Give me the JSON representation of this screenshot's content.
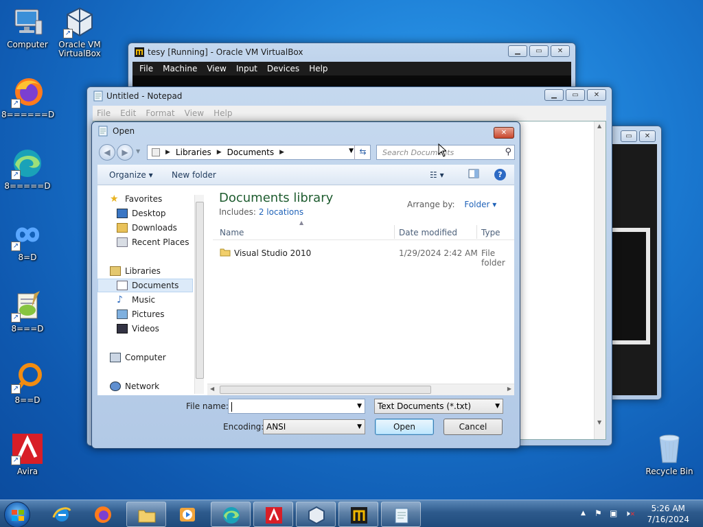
{
  "desktop": {
    "icons": [
      {
        "label": "Computer"
      },
      {
        "label": "Oracle VM VirtualBox"
      },
      {
        "label": "8======D"
      },
      {
        "label": "8=====D"
      },
      {
        "label": "8=D"
      },
      {
        "label": "8===D"
      },
      {
        "label": "8==D"
      },
      {
        "label": "Avira"
      },
      {
        "label": "Recycle Bin"
      }
    ]
  },
  "vbox": {
    "title": "tesy [Running] - Oracle VM VirtualBox",
    "menu": [
      "File",
      "Machine",
      "View",
      "Input",
      "Devices",
      "Help"
    ]
  },
  "notepad": {
    "title": "Untitled - Notepad",
    "menu": [
      "File",
      "Edit",
      "Format",
      "View",
      "Help"
    ]
  },
  "dialog": {
    "title": "Open",
    "breadcrumb": [
      "Libraries",
      "Documents"
    ],
    "search_placeholder": "Search Documents",
    "organize": "Organize",
    "new_folder": "New folder",
    "nav": {
      "favorites": "Favorites",
      "desktop": "Desktop",
      "downloads": "Downloads",
      "recent": "Recent Places",
      "libraries": "Libraries",
      "documents": "Documents",
      "music": "Music",
      "pictures": "Pictures",
      "videos": "Videos",
      "computer": "Computer",
      "network": "Network"
    },
    "library_title": "Documents library",
    "includes_label": "Includes:",
    "includes_link": "2 locations",
    "arrange_label": "Arrange by:",
    "arrange_value": "Folder",
    "columns": {
      "name": "Name",
      "date": "Date modified",
      "type": "Type"
    },
    "files": [
      {
        "name": "Visual Studio 2010",
        "date": "1/29/2024 2:42 AM",
        "type": "File folder"
      }
    ],
    "filename_label": "File name:",
    "filename_value": "",
    "filetype": "Text Documents (*.txt)",
    "encoding_label": "Encoding:",
    "encoding_value": "ANSI",
    "open_btn": "Open",
    "cancel_btn": "Cancel"
  },
  "taskbar": {
    "time": "5:26 AM",
    "date": "7/16/2024"
  },
  "colors": {
    "accent": "#1f62b8",
    "library_title": "#1e5c2f",
    "close_button": "#c9472d"
  }
}
